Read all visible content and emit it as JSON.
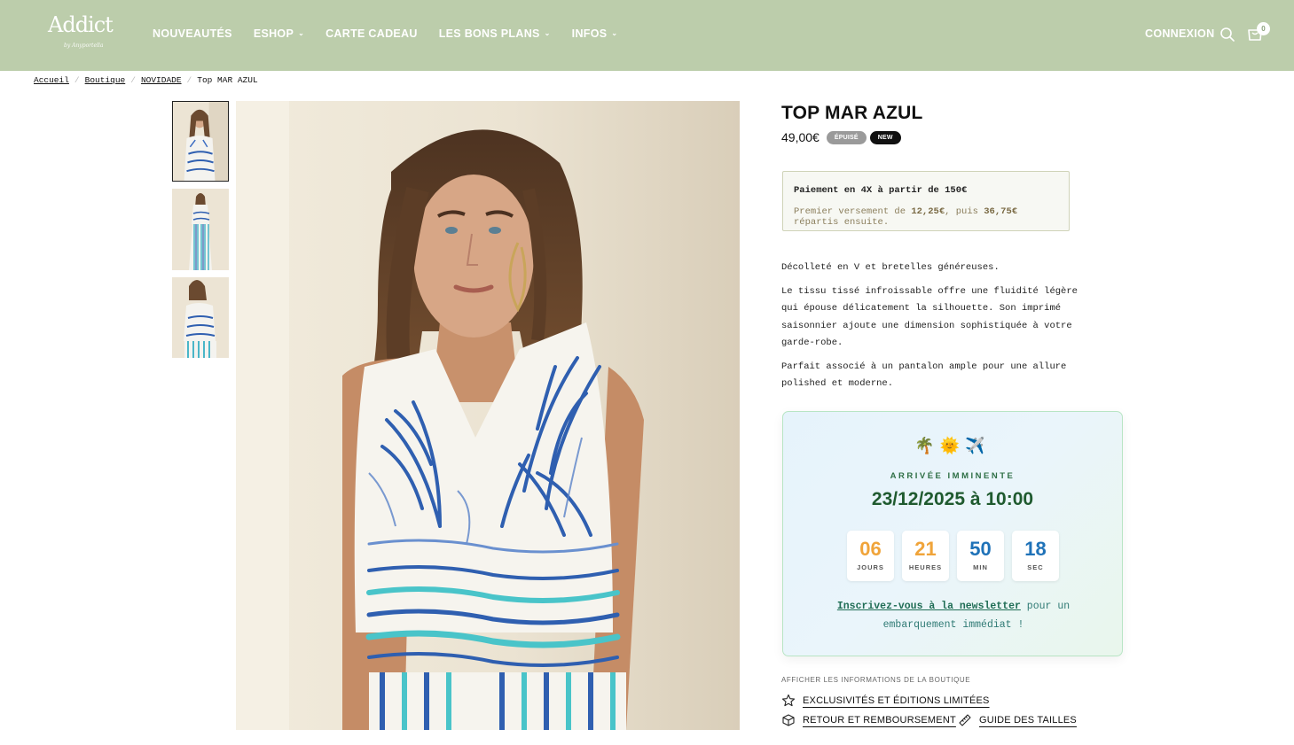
{
  "header": {
    "logo_text": "Addict",
    "logo_subtext": "by Anyportella",
    "nav": [
      {
        "label": "NOUVEAUTÉS",
        "has_dropdown": false
      },
      {
        "label": "ESHOP",
        "has_dropdown": true
      },
      {
        "label": "CARTE CADEAU",
        "has_dropdown": false
      },
      {
        "label": "LES BONS PLANS",
        "has_dropdown": true
      },
      {
        "label": "INFOS",
        "has_dropdown": true
      }
    ],
    "login_label": "CONNEXION",
    "cart_count": "0",
    "background_color": "#bccdab"
  },
  "breadcrumb": {
    "items": [
      "Accueil",
      "Boutique",
      "NOVIDADE"
    ],
    "current": "Top MAR AZUL"
  },
  "product": {
    "title": "TOP MAR AZUL",
    "price": "49,00€",
    "badge_sold": "ÉPUISÉ",
    "badge_new": "NEW",
    "payment": {
      "line1": "Paiement en 4X à partir de 150€",
      "line2_prefix": "Premier versement de ",
      "first_amount": "12,25€",
      "line2_mid": ", puis ",
      "rest_amount": "36,75€",
      "line2_suffix": " répartis ensuite."
    },
    "description": [
      "Décolleté en V et bretelles généreuses.",
      "Le tissu tissé infroissable offre une fluidité légère qui épouse délicatement la silhouette. Son imprimé saisonnier ajoute une dimension sophistiquée à votre garde-robe.",
      "Parfait associé à un pantalon ample pour une allure polished et moderne."
    ]
  },
  "countdown": {
    "emojis": "🌴🌞✈️",
    "heading": "ARRIVÉE IMMINENTE",
    "date": "23/12/2025 à 10:00",
    "units": [
      {
        "value": "06",
        "label": "JOURS",
        "color": "#f0a43a"
      },
      {
        "value": "21",
        "label": "HEURES",
        "color": "#f0a43a"
      },
      {
        "value": "50",
        "label": "MIN",
        "color": "#1f72b8"
      },
      {
        "value": "18",
        "label": "SEC",
        "color": "#1f72b8"
      }
    ],
    "newsletter_link": "Inscrivez-vous à la newsletter",
    "newsletter_rest": " pour un embarquement immédiat !"
  },
  "shop_info": {
    "heading": "AFFICHER LES INFORMATIONS DE LA BOUTIQUE",
    "links": [
      "EXCLUSIVITÉS ET ÉDITIONS LIMITÉES",
      "RETOUR ET REMBOURSEMENT",
      "GUIDE DES TAILLES"
    ]
  }
}
